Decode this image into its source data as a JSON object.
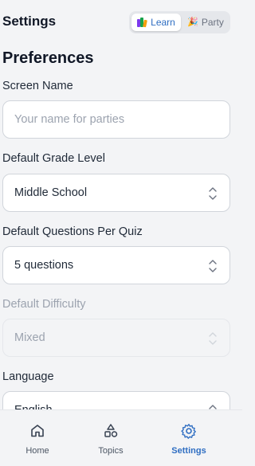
{
  "header": {
    "title": "Settings",
    "mode_toggle": {
      "learn_label": "Learn",
      "party_label": "Party",
      "active": "Learn"
    }
  },
  "preferences": {
    "title": "Preferences",
    "screen_name": {
      "label": "Screen Name",
      "value": "",
      "placeholder": "Your name for parties"
    },
    "grade_level": {
      "label": "Default Grade Level",
      "value": "Middle School"
    },
    "questions_per_quiz": {
      "label": "Default Questions Per Quiz",
      "value": "5 questions"
    },
    "difficulty": {
      "label": "Default Difficulty",
      "value": "Mixed",
      "disabled": true
    },
    "language": {
      "label": "Language",
      "value": "English"
    }
  },
  "bottom_nav": {
    "items": [
      {
        "label": "Home",
        "icon": "home-icon"
      },
      {
        "label": "Topics",
        "icon": "shapes-icon"
      },
      {
        "label": "Settings",
        "icon": "gear-icon",
        "active": true
      }
    ]
  },
  "colors": {
    "accent": "#2f6ec2",
    "background": "#f3f4f6",
    "text_primary": "#111827",
    "text_muted": "#9ca3af"
  }
}
